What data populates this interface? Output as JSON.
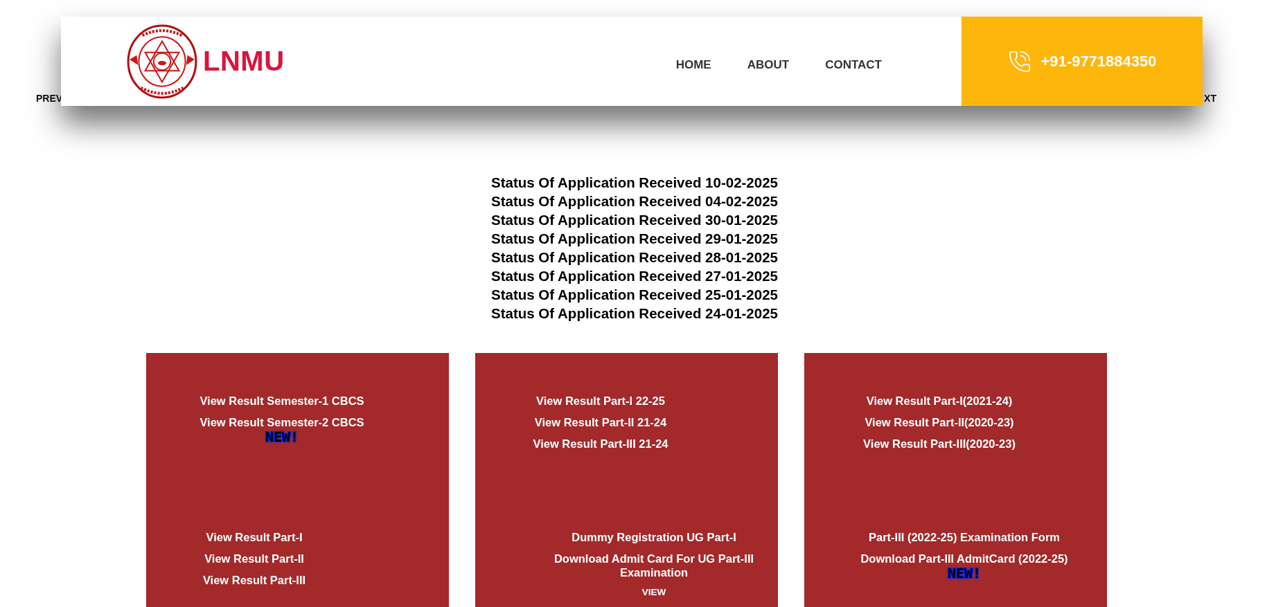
{
  "slider_nav": {
    "prev": "PREV",
    "next": "XT"
  },
  "header": {
    "logo_text": "LNMU",
    "nav": [
      {
        "label": "HOME"
      },
      {
        "label": "ABOUT"
      },
      {
        "label": "CONTACT"
      }
    ],
    "phone": "+91-9771884350"
  },
  "status_links": [
    "Status Of Application Received 10-02-2025",
    "Status Of Application Received 04-02-2025",
    "Status Of Application Received 30-01-2025",
    "Status Of Application Received 29-01-2025",
    "Status Of Application Received 28-01-2025",
    "Status Of Application Received 27-01-2025",
    "Status Of Application Received 25-01-2025",
    "Status Of Application Received 24-01-2025"
  ],
  "cards": [
    {
      "top": [
        {
          "kind": "link",
          "text": "View Result Semester-1 CBCS"
        },
        {
          "kind": "link",
          "text": "View Result Semester-2 CBCS",
          "badge": "NEW!"
        }
      ],
      "bottom": [
        {
          "kind": "link",
          "text": "View Result Part-I"
        },
        {
          "kind": "link",
          "text": "View Result Part-II"
        },
        {
          "kind": "link",
          "text": "View Result Part-III"
        }
      ]
    },
    {
      "top": [
        {
          "kind": "link",
          "text": "View Result Part-I 22-25"
        },
        {
          "kind": "link",
          "text": "View Result Part-II 21-24"
        },
        {
          "kind": "link",
          "text": "View Result Part-III 21-24"
        }
      ],
      "bottom": [
        {
          "kind": "link",
          "text": "Dummy Registration UG Part-I"
        },
        {
          "kind": "link",
          "text": "Download Admit Card For UG Part-III Examination"
        },
        {
          "kind": "small",
          "text": "VIEW"
        }
      ]
    },
    {
      "top": [
        {
          "kind": "link",
          "text": "View Result Part-I(2021-24)"
        },
        {
          "kind": "link",
          "text": "View Result Part-II(2020-23)"
        },
        {
          "kind": "link",
          "text": "View Result Part-III(2020-23)"
        }
      ],
      "bottom": [
        {
          "kind": "link",
          "text": "Part-III (2022-25) Examination Form"
        },
        {
          "kind": "link",
          "text": "Download Part-III AdmitCard (2022-25)",
          "badge": "NEW!"
        }
      ]
    }
  ]
}
